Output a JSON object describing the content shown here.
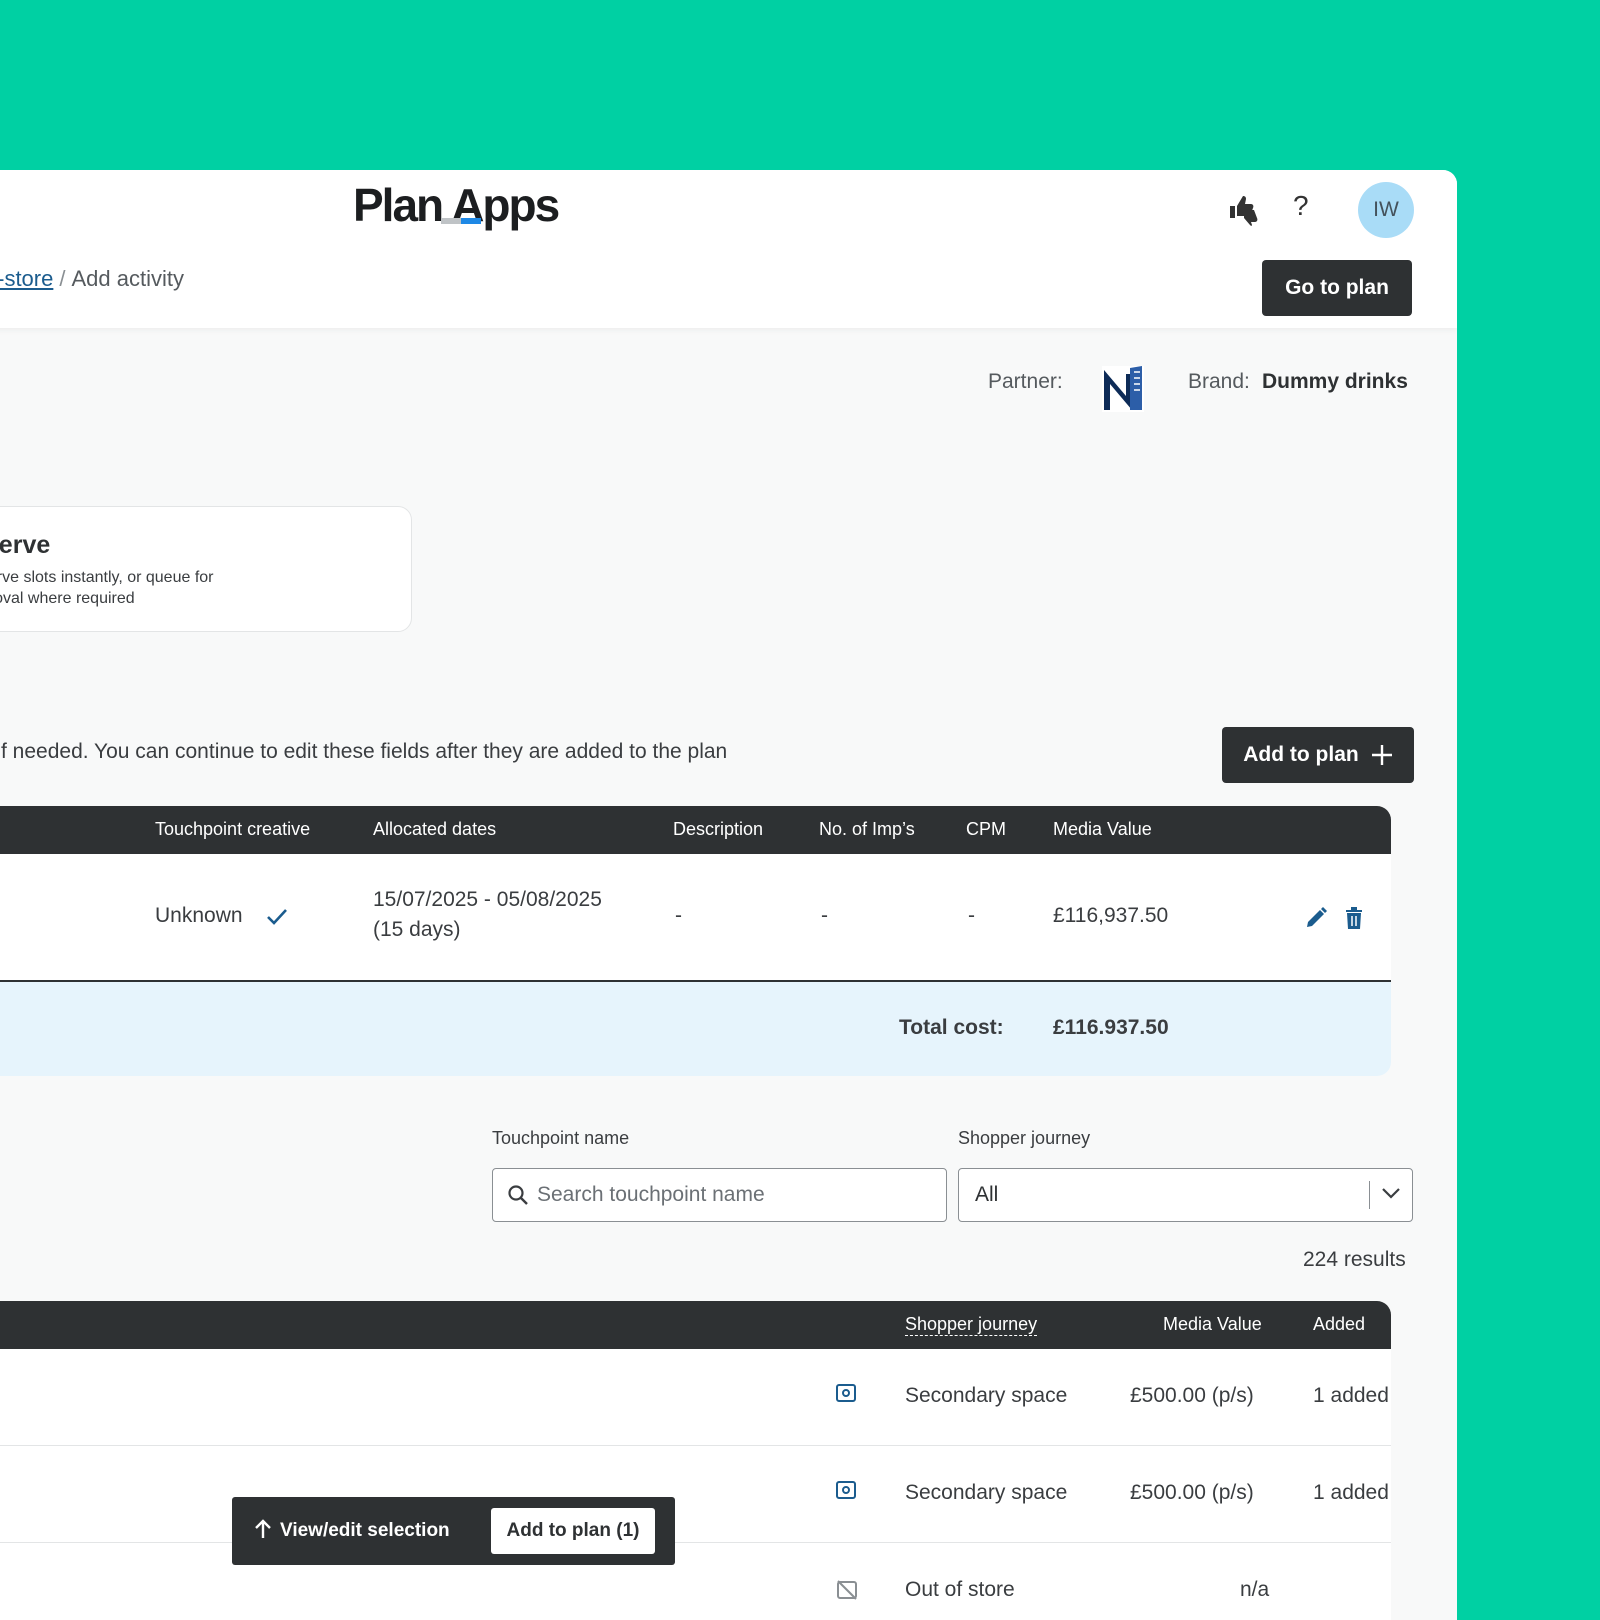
{
  "app": {
    "logo_text": "Plan Apps",
    "avatar_initials": "IW"
  },
  "breadcrumb": {
    "link": "in-store",
    "current": "Add activity"
  },
  "header": {
    "go_to_plan": "Go to plan"
  },
  "meta": {
    "partner_label": "Partner:",
    "brand_label": "Brand:",
    "brand_value": "Dummy drinks"
  },
  "card": {
    "title": "eserve",
    "desc": "eserve slots instantly, or queue for\npproval where required"
  },
  "instruction": "s if needed. You can continue to edit these fields after they are added to the plan",
  "add_to_plan": "Add to plan",
  "table1": {
    "headers": {
      "creative": "Touchpoint creative",
      "dates": "Allocated dates",
      "description": "Description",
      "imps": "No. of Imp’s",
      "cpm": "CPM",
      "media_value": "Media Value"
    },
    "row": {
      "creative": "Unknown",
      "dates": "15/07/2025 - 05/08/2025",
      "days": "(15 days)",
      "description": "-",
      "imps": "-",
      "cpm": "-",
      "media_value": "£116,937.50"
    },
    "total_label": "Total cost:",
    "total_value": "£116.937.50"
  },
  "filters": {
    "name_label": "Touchpoint name",
    "name_placeholder": "Search touchpoint name",
    "journey_label": "Shopper journey",
    "journey_value": "All",
    "results": "224 results"
  },
  "table2": {
    "headers": {
      "journey": "Shopper journey",
      "media_value": "Media Value",
      "added": "Added"
    },
    "rows": [
      {
        "journey": "Secondary space",
        "media_value": "£500.00 (p/s)",
        "added": "1 added"
      },
      {
        "journey": "Secondary space",
        "media_value": "£500.00 (p/s)",
        "added": "1 added"
      },
      {
        "journey": "Out of store",
        "media_value": "n/a",
        "added": ""
      }
    ]
  },
  "floatbar": {
    "view_edit": "View/edit selection",
    "add_to_plan": "Add to plan (1)"
  },
  "colors": {
    "background": "#00d0a3",
    "dark": "#2e3133",
    "link": "#1b5c8e",
    "total_bg": "#e6f4fc",
    "avatar": "#a9dcf7"
  },
  "icons": [
    "thumbs-up-down-icon",
    "help-icon",
    "plus-icon",
    "check-icon",
    "pencil-icon",
    "trash-icon",
    "search-icon",
    "chevron-down-icon",
    "eye-icon",
    "eye-off-icon",
    "arrow-up-icon",
    "partner-logo"
  ]
}
